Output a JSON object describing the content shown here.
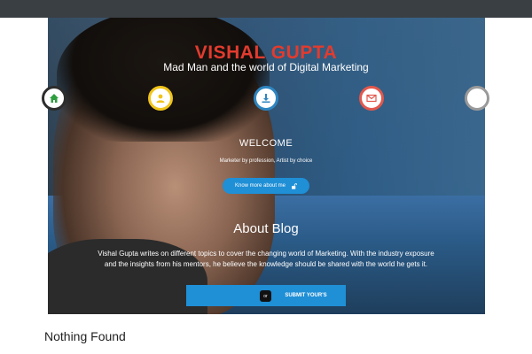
{
  "header": {
    "title": "VISHAL GUPTA",
    "subtitle": "Mad Man and the world of Digital Marketing"
  },
  "icon_nav": [
    {
      "icon": "home-icon",
      "color": "#2d2d2d",
      "icon_color": "#2e9e3f"
    },
    {
      "icon": "user-icon",
      "color": "#f0c419",
      "icon_color": "#f0c419"
    },
    {
      "icon": "download-icon",
      "color": "#2e86c1",
      "icon_color": "#2e86c1"
    },
    {
      "icon": "envelope-icon",
      "color": "#e2574c",
      "icon_color": "#e2574c"
    },
    {
      "icon": "empty-icon",
      "color": "#9a9a9a",
      "icon_color": "#9a9a9a"
    }
  ],
  "welcome": {
    "heading": "WELCOME",
    "tagline": "Marketer by profession, Artist by choice",
    "button_label": "Know more about me"
  },
  "about": {
    "heading": "About Blog",
    "description": "Vishal Gupta writes on different topics to cover the changing world of Marketing. With the industry exposure and the insights from his mentors, he believe the knowledge should be shared with the world he gets it."
  },
  "cta": {
    "left_label": "",
    "or_label": "or",
    "right_label": "SUBMIT YOUR'S"
  },
  "content": {
    "status": "Nothing Found"
  },
  "colors": {
    "accent": "#1f8fd6",
    "title_red": "#e23b2e"
  }
}
